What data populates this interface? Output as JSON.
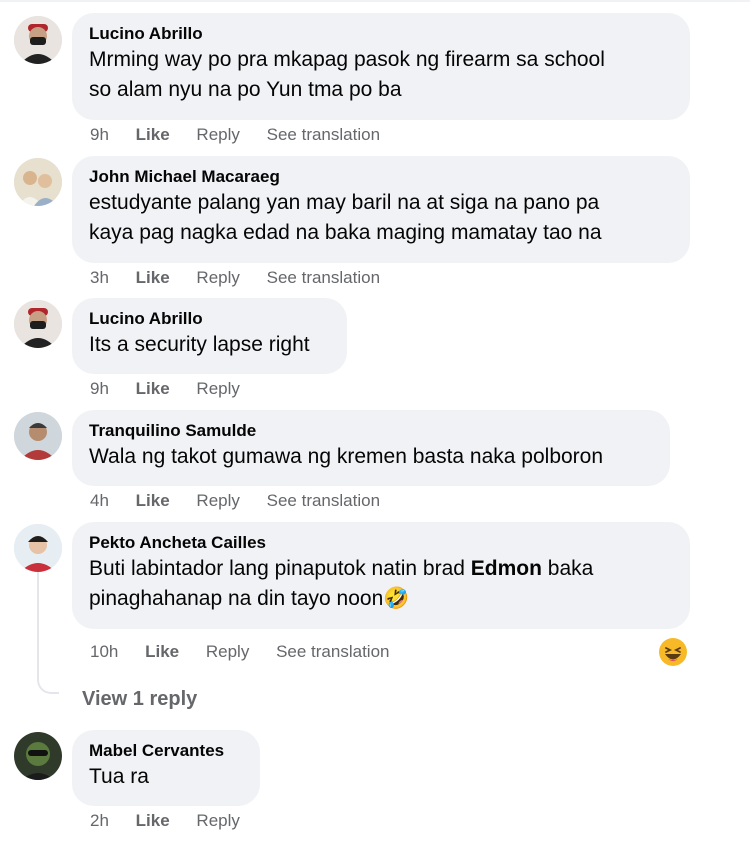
{
  "comments": [
    {
      "author": "Lucino Abrillo",
      "lines": [
        "Mrming way po pra mkapag pasok ng firearm sa school",
        "so alam nyu na po Yun tma po ba"
      ],
      "time": "9h",
      "like": "Like",
      "reply": "Reply",
      "translate": "See translation"
    },
    {
      "author": "John Michael Macaraeg",
      "lines": [
        "estudyante palang yan may baril na at siga na pano pa",
        "kaya pag nagka edad na baka maging mamatay tao na"
      ],
      "time": "3h",
      "like": "Like",
      "reply": "Reply",
      "translate": "See translation"
    },
    {
      "author": "Lucino Abrillo",
      "lines": [
        "Its a security lapse right"
      ],
      "time": "9h",
      "like": "Like",
      "reply": "Reply"
    },
    {
      "author": "Tranquilino Samulde",
      "lines": [
        "Wala ng takot gumawa ng kremen basta naka polboron"
      ],
      "time": "4h",
      "like": "Like",
      "reply": "Reply",
      "translate": "See translation"
    },
    {
      "author": "Pekto Ancheta Cailles",
      "line1_pre": "Buti labintador lang pinaputok natin brad ",
      "line1_mention": "Edmon",
      "line1_post": " baka",
      "line2": "pinaghahanap na din tayo noon",
      "emoji": "🤣",
      "time": "10h",
      "like": "Like",
      "reply": "Reply",
      "translate": "See translation",
      "view_replies": "View 1 reply"
    },
    {
      "author": "Mabel Cervantes",
      "lines": [
        "Tua ra"
      ],
      "time": "2h",
      "like": "Like",
      "reply": "Reply"
    }
  ],
  "colors": {
    "bubble": "#f0f2f5",
    "text": "#050505",
    "meta": "#65676b",
    "thread_line": "#e4e6eb",
    "reaction": "#f7b928"
  }
}
